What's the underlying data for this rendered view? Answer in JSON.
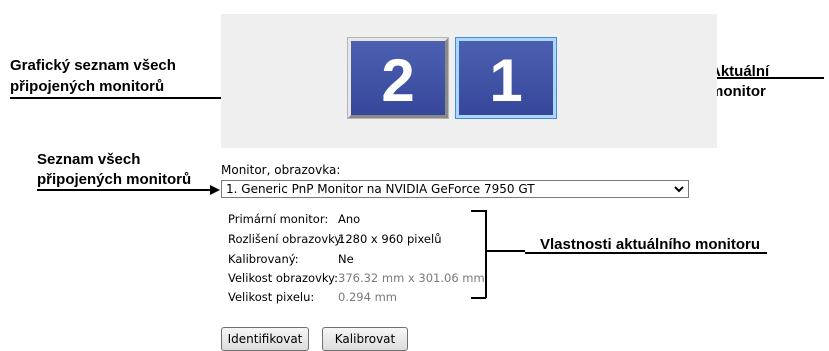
{
  "callouts": {
    "graphic_list": [
      "Grafický seznam všech",
      "připojených monitorů"
    ],
    "current_monitor": "Aktuální monitor",
    "monitor_list": [
      "Seznam všech",
      "připojených monitorů"
    ],
    "properties": "Vlastnosti aktuálního monitoru"
  },
  "monitors": [
    {
      "number": "2",
      "selected": false
    },
    {
      "number": "1",
      "selected": true
    }
  ],
  "monitor_field": {
    "label": "Monitor, obrazovka:",
    "selected_value": "1. Generic PnP Monitor na NVIDIA GeForce 7950 GT"
  },
  "properties": [
    {
      "label": "Primární monitor:",
      "value": "Ano",
      "muted": false
    },
    {
      "label": "Rozlišení obrazovky:",
      "value": "1280 x 960 pixelů",
      "muted": false
    },
    {
      "label": "Kalibrovaný:",
      "value": "Ne",
      "muted": false
    },
    {
      "label": "Velikost obrazovky:",
      "value": "376.32 mm x 301.06 mm",
      "muted": true
    },
    {
      "label": "Velikost pixelu:",
      "value": "0.294 mm",
      "muted": true
    }
  ],
  "buttons": {
    "identify": "Identifikovat",
    "calibrate": "Kalibrovat"
  },
  "icons": {
    "dropdown": "chevron-down-icon"
  }
}
